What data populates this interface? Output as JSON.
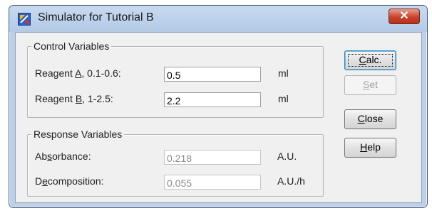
{
  "window": {
    "title": "Simulator for Tutorial B",
    "close_glyph": "✕",
    "app_icon": "simulator-app-icon"
  },
  "control_variables": {
    "legend": "Control Variables",
    "rows": [
      {
        "label_pre": "Reagent ",
        "label_key": "A",
        "label_post": ", 0.1-0.6:",
        "value": "0.5",
        "unit": "ml"
      },
      {
        "label_pre": "Reagent ",
        "label_key": "B",
        "label_post": ", 1-2.5:",
        "value": "2.2",
        "unit": "ml"
      }
    ]
  },
  "response_variables": {
    "legend": "Response Variables",
    "rows": [
      {
        "label_pre": "Ab",
        "label_key": "s",
        "label_post": "orbance:",
        "value": "0.218",
        "unit": "A.U."
      },
      {
        "label_pre": "D",
        "label_key": "e",
        "label_post": "composition:",
        "value": "0.055",
        "unit": "A.U./h"
      }
    ]
  },
  "buttons": {
    "calc": {
      "pre": "",
      "key": "C",
      "post": "alc."
    },
    "set": {
      "pre": "",
      "key": "S",
      "post": "et"
    },
    "close": {
      "pre": "",
      "key": "C",
      "post": "lose"
    },
    "help": {
      "pre": "",
      "key": "H",
      "post": "elp"
    }
  }
}
